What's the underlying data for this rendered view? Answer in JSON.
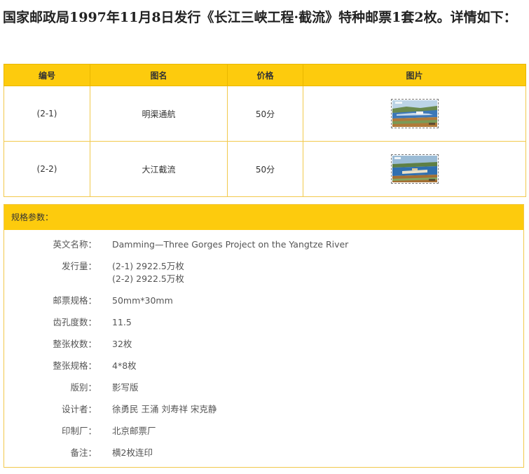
{
  "intro": "国家邮政局1997年11月8日发行《长江三峡工程·截流》特种邮票1套2枚。详情如下：",
  "table": {
    "headers": {
      "number": "编号",
      "name": "图名",
      "price": "价格",
      "image": "图片"
    },
    "rows": [
      {
        "number": "(2-1)",
        "name": "明渠通航",
        "price": "50分"
      },
      {
        "number": "(2-2)",
        "name": "大江截流",
        "price": "50分"
      }
    ]
  },
  "specs": {
    "title": "规格参数：",
    "english_name": {
      "label": "英文名称：",
      "value": "Damming—Three Gorges Project on the Yangtze River"
    },
    "circulation": {
      "label": "发行量：",
      "values": [
        "(2-1) 2922.5万枚",
        "(2-2) 2922.5万枚"
      ]
    },
    "stamp_size": {
      "label": "邮票规格：",
      "value": "50mm*30mm"
    },
    "perforation": {
      "label": "齿孔度数：",
      "value": "11.5"
    },
    "sheet_count": {
      "label": "整张枚数：",
      "value": "32枚"
    },
    "sheet_layout": {
      "label": "整张规格：",
      "value": "4*8枚"
    },
    "print_method": {
      "label": "版别：",
      "value": "影写版"
    },
    "designers": {
      "label": "设计者：",
      "value": "徐勇民 王涌 刘寿祥 宋克静"
    },
    "printer": {
      "label": "印制厂：",
      "value": "北京邮票厂"
    },
    "remarks": {
      "label": "备注：",
      "value": "横2枚连印"
    }
  }
}
